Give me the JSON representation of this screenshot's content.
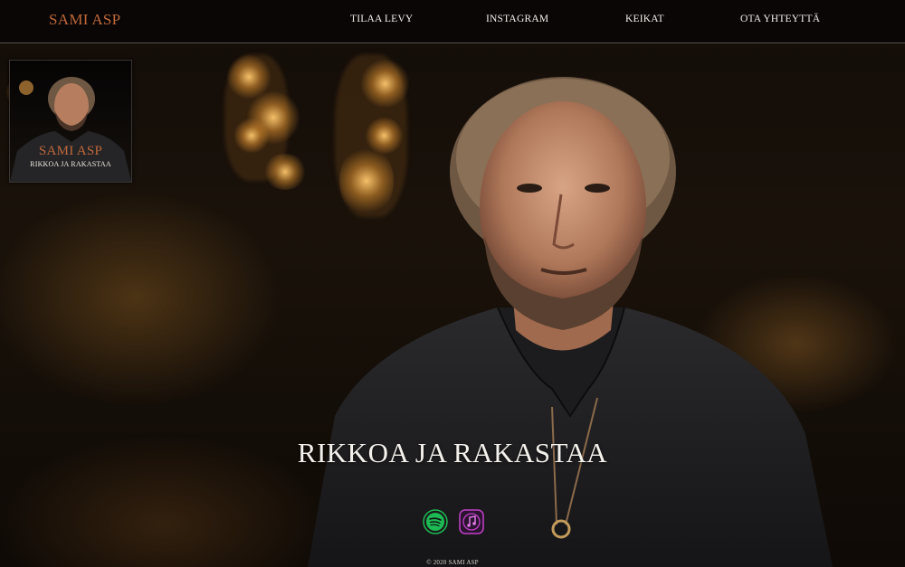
{
  "header": {
    "brand": "SAMI ASP",
    "nav": [
      {
        "label": "TILAA LEVY"
      },
      {
        "label": "INSTAGRAM"
      },
      {
        "label": "KEIKAT"
      },
      {
        "label": "OTA YHTEYTTÄ"
      }
    ]
  },
  "album": {
    "artist": "SAMI ASP",
    "title": "RIKKOA JA RAKASTAA"
  },
  "hero": {
    "title": "RIKKOA JA RAKASTAA"
  },
  "streaming": [
    {
      "service": "Spotify",
      "icon": "spotify-icon",
      "color": "#1db954"
    },
    {
      "service": "Apple Music",
      "icon": "music-note-icon",
      "color": "#c340c9"
    }
  ],
  "footer": {
    "copyright": "© 2020 SAMI ASP"
  },
  "colors": {
    "accent": "#c0683a",
    "nav_text": "#f2efea",
    "background": "#0d0906"
  }
}
